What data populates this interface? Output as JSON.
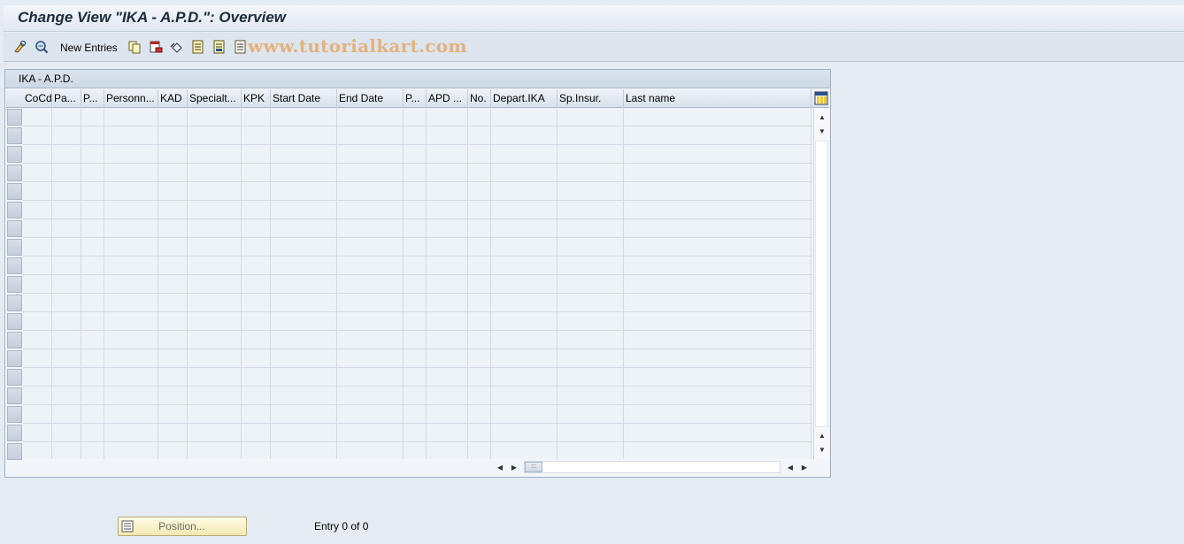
{
  "title": "Change View \"IKA - A.P.D.\": Overview",
  "toolbar": {
    "new_entries_label": "New Entries",
    "icons": [
      "edit-glasses-icon",
      "display-change-icon",
      "copy-icon",
      "delete-icon",
      "undo-icon",
      "select-all-icon",
      "select-block-icon",
      "deselect-all-icon"
    ]
  },
  "watermark": "www.tutorialkart.com",
  "panel": {
    "title": "IKA - A.P.D.",
    "columns": [
      {
        "label": "CoCd"
      },
      {
        "label": "Pa..."
      },
      {
        "label": "P..."
      },
      {
        "label": "Personn..."
      },
      {
        "label": "KAD"
      },
      {
        "label": "Specialt..."
      },
      {
        "label": "KPK"
      },
      {
        "label": "Start Date"
      },
      {
        "label": "End Date"
      },
      {
        "label": "P..."
      },
      {
        "label": "APD ..."
      },
      {
        "label": "No."
      },
      {
        "label": "Depart.IKA"
      },
      {
        "label": "Sp.Insur."
      },
      {
        "label": "Last name"
      }
    ],
    "row_count": 19
  },
  "footer": {
    "position_label": "Position...",
    "entry_text": "Entry 0 of 0"
  },
  "colors": {
    "background": "#e4ebf2",
    "title_text": "#1c2a3c",
    "watermark": "#e6a05a",
    "position_button": "#f3e9b0"
  }
}
